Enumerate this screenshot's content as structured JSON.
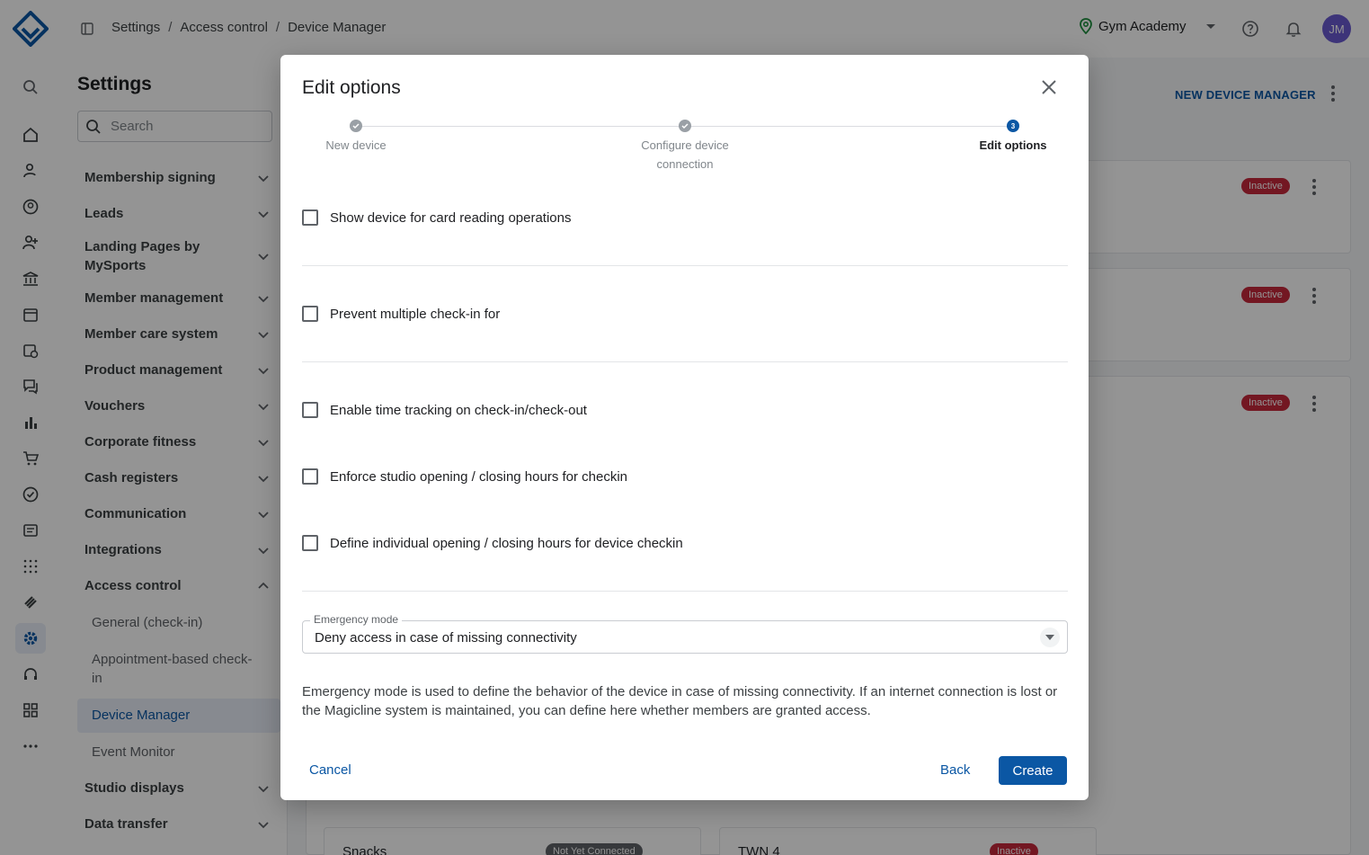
{
  "topbar": {
    "breadcrumbs": [
      "Settings",
      "Access control",
      "Device Manager"
    ],
    "studio_name": "Gym Academy",
    "avatar_initials": "JM"
  },
  "settings": {
    "title": "Settings",
    "search_placeholder": "Search",
    "items": [
      {
        "label": "Membership signing"
      },
      {
        "label": "Leads"
      },
      {
        "label": "Landing Pages by MySports"
      },
      {
        "label": "Member management"
      },
      {
        "label": "Member care system"
      },
      {
        "label": "Product management"
      },
      {
        "label": "Vouchers"
      },
      {
        "label": "Corporate fitness"
      },
      {
        "label": "Cash registers"
      },
      {
        "label": "Communication"
      },
      {
        "label": "Integrations"
      },
      {
        "label": "Access control"
      },
      {
        "label": "Studio displays"
      },
      {
        "label": "Data transfer"
      }
    ],
    "access_sub": [
      "General (check-in)",
      "Appointment-based check-in",
      "Device Manager",
      "Event Monitor"
    ]
  },
  "background": {
    "new_button": "NEW DEVICE MANAGER",
    "badges": [
      "Inactive",
      "Inactive",
      "Inactive",
      "Not Yet Connected",
      "Inactive"
    ],
    "cards": [
      "Snacks",
      "TWN 4"
    ]
  },
  "modal": {
    "title": "Edit options",
    "steps": [
      "New device",
      "Configure device connection",
      "Edit options"
    ],
    "current_step_number": "3",
    "options": [
      "Show device for card reading operations",
      "Prevent multiple check-in for",
      "Enable time tracking on check-in/check-out",
      "Enforce studio opening / closing hours for checkin",
      "Define individual opening / closing hours for device checkin"
    ],
    "emergency": {
      "label": "Emergency mode",
      "value": "Deny access in case of missing connectivity",
      "help": "Emergency mode is used to define the behavior of the device in case of missing connectivity. If an internet connection is lost or the Magicline system is maintained, you can define here whether members are granted access."
    },
    "cancel": "Cancel",
    "back": "Back",
    "create": "Create"
  },
  "colors": {
    "accent": "#0b57a4",
    "inactive": "#c6283b",
    "avatar": "#6a5ad1"
  }
}
